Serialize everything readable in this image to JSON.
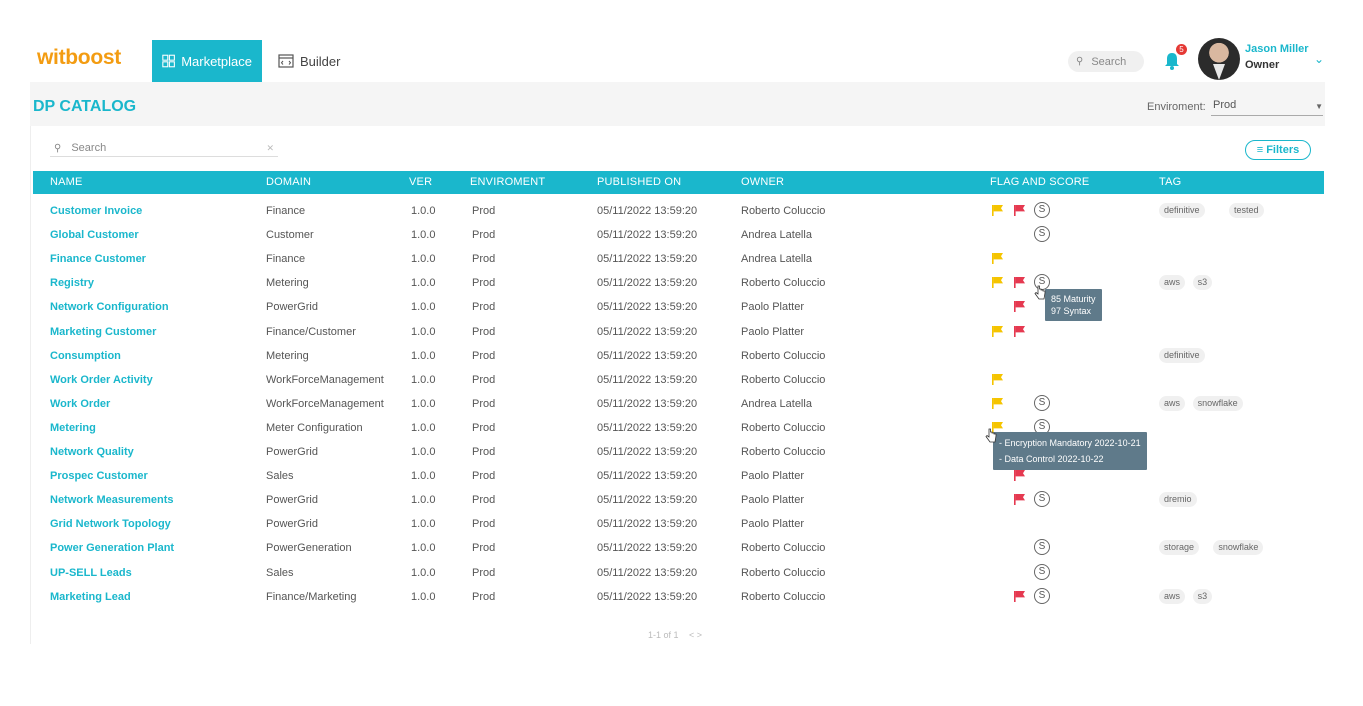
{
  "app": {
    "logo": "witboost",
    "nav": [
      {
        "label": "Marketplace",
        "icon": "grid-icon",
        "active": true
      },
      {
        "label": "Builder",
        "icon": "code-window-icon",
        "active": false
      }
    ],
    "search_placeholder": "Search",
    "notifications_count": "5",
    "user": {
      "name": "Jason Miller",
      "role": "Owner"
    }
  },
  "catalog": {
    "title": "DP CATALOG",
    "environment_label": "Enviroment:",
    "environment_value": "Prod",
    "search_placeholder": "Search",
    "filters_label": "Filters",
    "columns": [
      "NAME",
      "DOMAIN",
      "VER",
      "ENVIROMENT",
      "PUBLISHED ON",
      "OWNER",
      "FLAG AND SCORE",
      "TAG"
    ],
    "rows": [
      {
        "name": "Customer Invoice",
        "domain": "Finance",
        "ver": "1.0.0",
        "env": "Prod",
        "published": "05/11/2022 13:59:20",
        "owner": "Roberto Coluccio",
        "yellow": true,
        "red": true,
        "score": true,
        "tags": [
          "definitive",
          "tested"
        ]
      },
      {
        "name": "Global Customer",
        "domain": "Customer",
        "ver": "1.0.0",
        "env": "Prod",
        "published": "05/11/2022 13:59:20",
        "owner": "Andrea Latella",
        "yellow": false,
        "red": false,
        "score": true,
        "tags": []
      },
      {
        "name": "Finance Customer",
        "domain": "Finance",
        "ver": "1.0.0",
        "env": "Prod",
        "published": "05/11/2022 13:59:20",
        "owner": "Andrea Latella",
        "yellow": true,
        "red": false,
        "score": false,
        "tags": []
      },
      {
        "name": "Registry",
        "domain": "Metering",
        "ver": "1.0.0",
        "env": "Prod",
        "published": "05/11/2022 13:59:20",
        "owner": "Roberto Coluccio",
        "yellow": true,
        "red": true,
        "score": true,
        "tags": [
          "aws",
          "s3"
        ]
      },
      {
        "name": "Network Configuration",
        "domain": "PowerGrid",
        "ver": "1.0.0",
        "env": "Prod",
        "published": "05/11/2022 13:59:20",
        "owner": "Paolo Platter",
        "yellow": false,
        "red": true,
        "score": false,
        "tags": []
      },
      {
        "name": "Marketing Customer",
        "domain": "Finance/Customer",
        "ver": "1.0.0",
        "env": "Prod",
        "published": "05/11/2022 13:59:20",
        "owner": "Paolo Platter",
        "yellow": true,
        "red": true,
        "score": false,
        "tags": []
      },
      {
        "name": "Consumption",
        "domain": "Metering",
        "ver": "1.0.0",
        "env": "Prod",
        "published": "05/11/2022 13:59:20",
        "owner": "Roberto Coluccio",
        "yellow": false,
        "red": false,
        "score": false,
        "tags": [
          "definitive"
        ]
      },
      {
        "name": "Work Order Activity",
        "domain": "WorkForceManagement",
        "ver": "1.0.0",
        "env": "Prod",
        "published": "05/11/2022 13:59:20",
        "owner": "Roberto Coluccio",
        "yellow": true,
        "red": false,
        "score": false,
        "tags": []
      },
      {
        "name": "Work Order",
        "domain": "WorkForceManagement",
        "ver": "1.0.0",
        "env": "Prod",
        "published": "05/11/2022 13:59:20",
        "owner": "Andrea Latella",
        "yellow": true,
        "red": false,
        "score": true,
        "tags": [
          "aws",
          "snowflake"
        ]
      },
      {
        "name": "Metering",
        "domain": "Meter Configuration",
        "ver": "1.0.0",
        "env": "Prod",
        "published": "05/11/2022 13:59:20",
        "owner": "Roberto Coluccio",
        "yellow": true,
        "red": false,
        "score": true,
        "tags": []
      },
      {
        "name": "Network Quality",
        "domain": "PowerGrid",
        "ver": "1.0.0",
        "env": "Prod",
        "published": "05/11/2022 13:59:20",
        "owner": "Roberto Coluccio",
        "yellow": false,
        "red": false,
        "score": false,
        "tags": []
      },
      {
        "name": "Prospec Customer",
        "domain": "Sales",
        "ver": "1.0.0",
        "env": "Prod",
        "published": "05/11/2022 13:59:20",
        "owner": "Paolo Platter",
        "yellow": false,
        "red": true,
        "score": false,
        "tags": []
      },
      {
        "name": "Network Measurements",
        "domain": "PowerGrid",
        "ver": "1.0.0",
        "env": "Prod",
        "published": "05/11/2022 13:59:20",
        "owner": "Paolo Platter",
        "yellow": false,
        "red": true,
        "score": true,
        "tags": [
          "dremio"
        ]
      },
      {
        "name": "Grid Network Topology",
        "domain": "PowerGrid",
        "ver": "1.0.0",
        "env": "Prod",
        "published": "05/11/2022 13:59:20",
        "owner": "Paolo Platter",
        "yellow": false,
        "red": false,
        "score": false,
        "tags": []
      },
      {
        "name": "Power Generation Plant",
        "domain": "PowerGeneration",
        "ver": "1.0.0",
        "env": "Prod",
        "published": "05/11/2022 13:59:20",
        "owner": "Roberto Coluccio",
        "yellow": false,
        "red": false,
        "score": true,
        "tags": [
          "storage",
          "snowflake"
        ]
      },
      {
        "name": "UP-SELL Leads",
        "domain": "Sales",
        "ver": "1.0.0",
        "env": "Prod",
        "published": "05/11/2022 13:59:20",
        "owner": "Roberto Coluccio",
        "yellow": false,
        "red": false,
        "score": true,
        "tags": []
      },
      {
        "name": "Marketing Lead",
        "domain": "Finance/Marketing",
        "ver": "1.0.0",
        "env": "Prod",
        "published": "05/11/2022 13:59:20",
        "owner": "Roberto Coluccio",
        "yellow": false,
        "red": true,
        "score": true,
        "tags": [
          "aws",
          "s3"
        ]
      }
    ],
    "score_tooltip": [
      "85 Maturity",
      "97 Syntax"
    ],
    "flag_tooltip": [
      "- Encryption Mandatory  2022-10-21",
      "- Data Control  2022-10-22"
    ],
    "pagination": "1-1 of 1",
    "pagination_arrows": "< >"
  },
  "colors": {
    "accent": "#1ab7cc",
    "logo": "#f39c12",
    "flag_yellow": "#f5c400",
    "flag_red": "#e53950",
    "tooltip_bg": "#5f7a8a"
  }
}
